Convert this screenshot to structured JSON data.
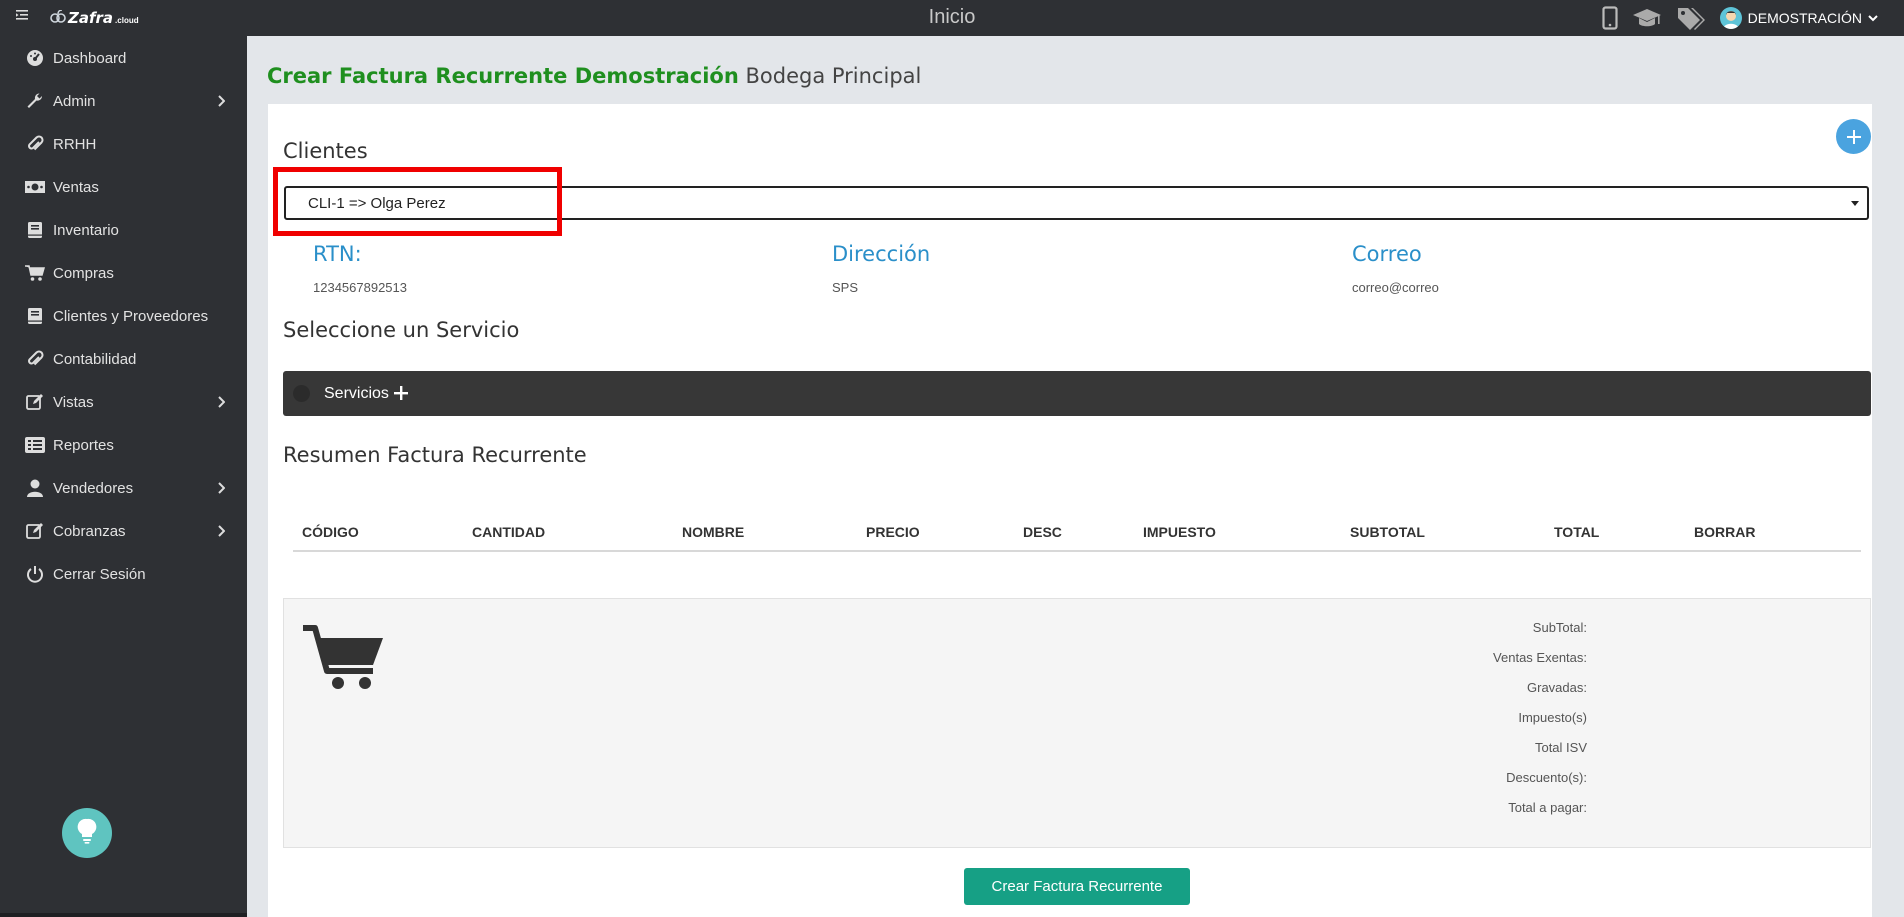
{
  "topbar": {
    "brand_name": "Zafra",
    "brand_suffix": ".cloud",
    "page_title": "Inicio",
    "user_name": "DEMOSTRACIÓN"
  },
  "sidebar": {
    "items": [
      {
        "label": "Dashboard",
        "icon": "dashboard-icon",
        "has_submenu": false
      },
      {
        "label": "Admin",
        "icon": "wrench-icon",
        "has_submenu": true
      },
      {
        "label": "RRHH",
        "icon": "paperclip-icon",
        "has_submenu": false
      },
      {
        "label": "Ventas",
        "icon": "money-icon",
        "has_submenu": false
      },
      {
        "label": "Inventario",
        "icon": "book-icon",
        "has_submenu": false
      },
      {
        "label": "Compras",
        "icon": "cart-icon",
        "has_submenu": false
      },
      {
        "label": "Clientes y Proveedores",
        "icon": "book-icon",
        "has_submenu": false
      },
      {
        "label": "Contabilidad",
        "icon": "paperclip-icon",
        "has_submenu": false
      },
      {
        "label": "Vistas",
        "icon": "edit-icon",
        "has_submenu": true
      },
      {
        "label": "Reportes",
        "icon": "list-icon",
        "has_submenu": false
      },
      {
        "label": "Vendedores",
        "icon": "user-icon",
        "has_submenu": true
      },
      {
        "label": "Cobranzas",
        "icon": "edit-icon",
        "has_submenu": true
      },
      {
        "label": "Cerrar Sesión",
        "icon": "power-icon",
        "has_submenu": false
      }
    ]
  },
  "page": {
    "heading_main": "Crear Factura Recurrente Demostración",
    "heading_sub": "Bodega Principal",
    "clientes_title": "Clientes",
    "client_selected": "CLI-1 => Olga Perez",
    "rtn_label": "RTN:",
    "rtn_value": "1234567892513",
    "direccion_label": "Dirección",
    "direccion_value": "SPS",
    "correo_label": "Correo",
    "correo_value": "correo@correo",
    "servicio_title": "Seleccione un Servicio",
    "servicios_label": "Servicios",
    "resumen_title": "Resumen Factura Recurrente",
    "columns": [
      "CÓDIGO",
      "CANTIDAD",
      "NOMBRE",
      "PRECIO",
      "DESC",
      "IMPUESTO",
      "SUBTOTAL",
      "TOTAL",
      "BORRAR"
    ],
    "summary_labels": [
      "SubTotal:",
      "Ventas Exentas:",
      "Gravadas:",
      "Impuesto(s)",
      "Total ISV",
      "Descuento(s):",
      "Total a pagar:"
    ],
    "create_button": "Crear Factura Recurrente"
  },
  "colors": {
    "heading_green": "#1f8f1f",
    "info_blue": "#2a8fc9",
    "button_teal": "#16a085",
    "highlight_red": "#f00000"
  }
}
